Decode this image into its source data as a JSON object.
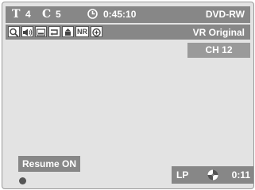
{
  "status": {
    "title_symbol": "T",
    "title_number": "4",
    "chapter_symbol": "C",
    "chapter_number": "5",
    "elapsed_time": "0:45:10",
    "disc_type": "DVD-RW"
  },
  "icon_row": {
    "icons": [
      "search-icon",
      "audio-icon",
      "subtitle-icon",
      "repeat-icon",
      "angle-icon",
      "noise-reduction-icon",
      "zoom-icon"
    ],
    "nr_label": "NR",
    "format_label": "VR Original"
  },
  "chapter_display": "CH 12",
  "resume_label": "Resume ON",
  "playback": {
    "mode": "LP",
    "time": "0:11"
  },
  "colors": {
    "bar": "#878787",
    "screen": "#e3e3e3",
    "text": "#ffffff"
  }
}
